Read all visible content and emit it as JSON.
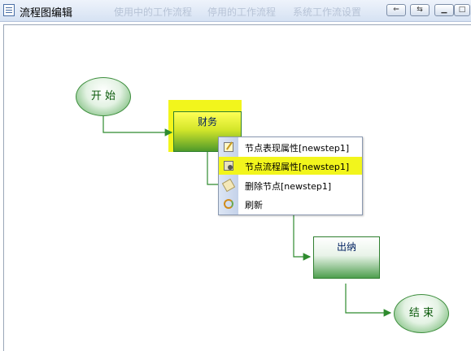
{
  "window": {
    "title": "流程图编辑"
  },
  "tabs": [
    "使用中的工作流程",
    "停用的工作流程",
    "系统工作流设置"
  ],
  "nodes": {
    "start": "开 始",
    "finance": "财务",
    "cashier": "出纳",
    "end": "结 束"
  },
  "context_menu": {
    "items": [
      {
        "label": "节点表现属性[newstep1]",
        "icon": "edit-icon"
      },
      {
        "label": "节点流程属性[newstep1]",
        "icon": "properties-icon"
      },
      {
        "label": "删除节点[newstep1]",
        "icon": "eraser-icon"
      },
      {
        "label": "刷新",
        "icon": "refresh-icon"
      }
    ]
  },
  "colors": {
    "highlight": "#f2f51c",
    "connector": "#2e8b2e",
    "node_border": "#3f8f3f"
  }
}
